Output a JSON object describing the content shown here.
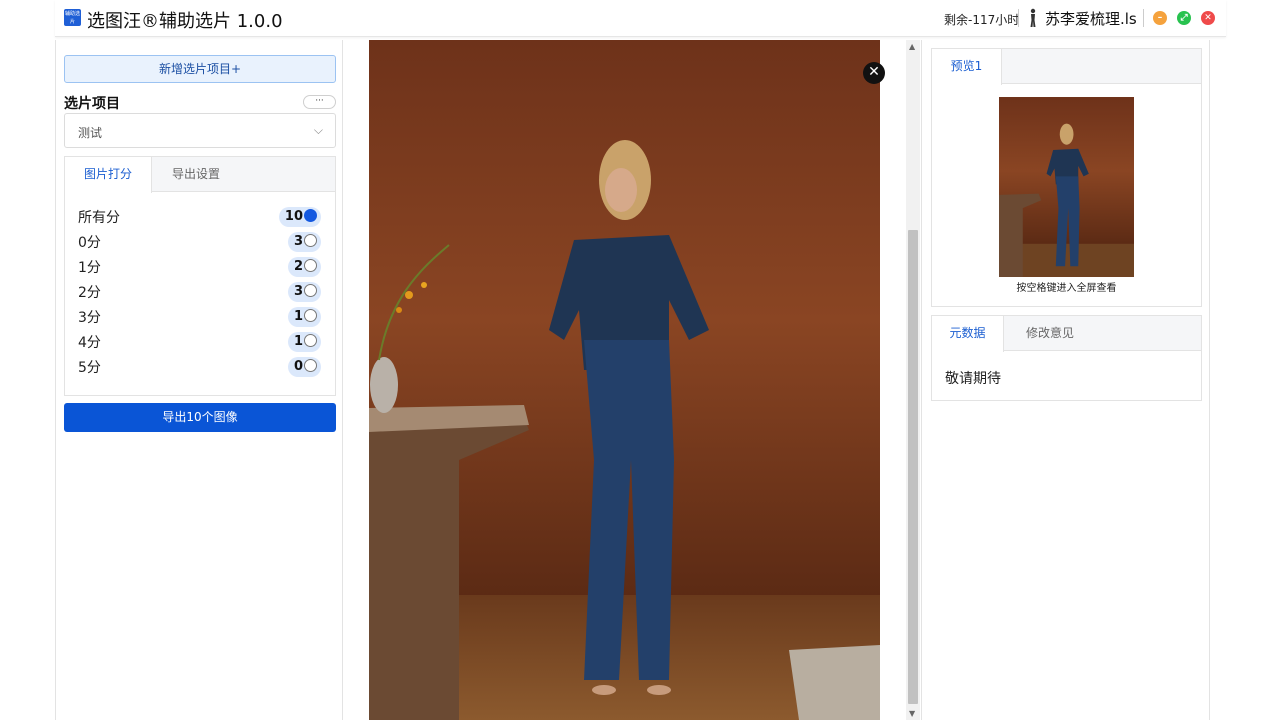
{
  "app": {
    "logo_text": "辅助选片",
    "title": "选图汪®辅助选片 1.0.0",
    "remaining": "剩余-117小时",
    "user_name": "苏李爱梳理.ls",
    "window_buttons": {
      "minimize": "–",
      "maximize": "⤢",
      "close": "✕"
    }
  },
  "left": {
    "new_project_label": "新增选片项目+",
    "section_title": "选片项目",
    "more_label": "···",
    "project_select": {
      "value": "测试",
      "chevron": "⌵"
    },
    "tabs": [
      {
        "label": "图片打分",
        "active": true
      },
      {
        "label": "导出设置",
        "active": false
      }
    ],
    "scores": [
      {
        "label": "所有分",
        "count": "10",
        "selected": true
      },
      {
        "label": "0分",
        "count": "3",
        "selected": false
      },
      {
        "label": "1分",
        "count": "2",
        "selected": false
      },
      {
        "label": "2分",
        "count": "3",
        "selected": false
      },
      {
        "label": "3分",
        "count": "1",
        "selected": false
      },
      {
        "label": "4分",
        "count": "1",
        "selected": false
      },
      {
        "label": "5分",
        "count": "0",
        "selected": false
      }
    ],
    "export_label": "导出10个图像"
  },
  "viewer": {
    "close_glyph": "✕",
    "scroll_up": "▲",
    "scroll_down": "▼"
  },
  "right": {
    "preview_tab": "预览1",
    "preview_hint": "按空格键进入全屏查看",
    "meta_tabs": [
      {
        "label": "元数据",
        "active": true
      },
      {
        "label": "修改意见",
        "active": false
      }
    ],
    "meta_text": "敬请期待"
  },
  "colors": {
    "accent": "#0a55d6",
    "active_tab_text": "#1b5ed1",
    "pill_bg": "#dbe8fb",
    "min": "#f5a23d",
    "max": "#28c24f",
    "close": "#ef4a4a"
  }
}
